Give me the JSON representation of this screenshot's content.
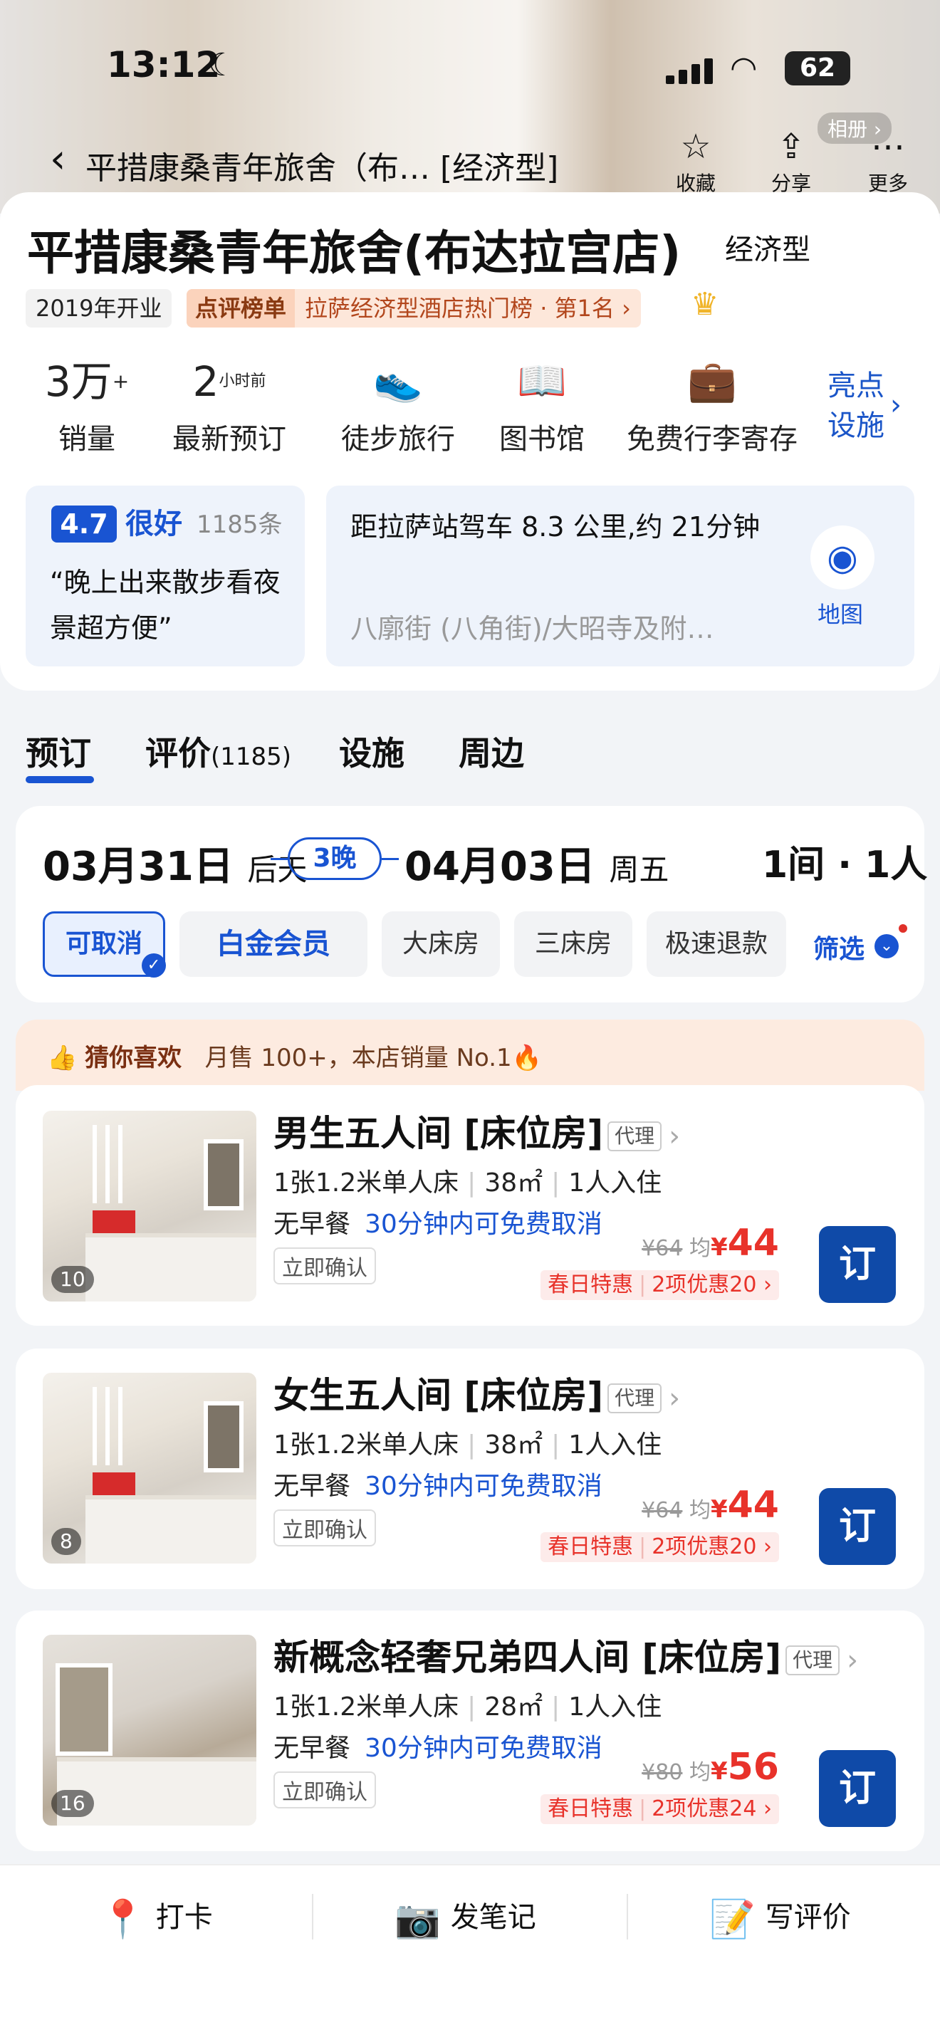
{
  "status_bar": {
    "time": "13:12",
    "moon": "☾",
    "wifi": "📶",
    "battery": "62"
  },
  "nav": {
    "back": "‹",
    "title": "平措康桑青年旅舍（布… [经济型]",
    "album": "相册 ›",
    "actions": [
      {
        "icon": "☆",
        "label": "收藏"
      },
      {
        "icon": "⇪",
        "label": "分享"
      },
      {
        "icon": "⋯",
        "label": "更多"
      }
    ]
  },
  "hotel": {
    "name": "平措康桑青年旅舍(布达拉宫店)",
    "type": "经济型",
    "opened": "2019年开业",
    "rank_badge": "点评榜单",
    "rank_text": "拉萨经济型酒店热门榜 · 第1名 ›",
    "crown": "♛"
  },
  "stats": [
    {
      "value": "3万",
      "sup": "+",
      "label": "销量"
    },
    {
      "value": "2",
      "small": "小时前",
      "label": "最新预订"
    }
  ],
  "facilities": [
    {
      "icon": "👟",
      "label": "徒步旅行"
    },
    {
      "icon": "📖",
      "label": "图书馆"
    },
    {
      "icon": "💼",
      "label": "免费行李寄存"
    }
  ],
  "highlights_link": "亮点\n设施",
  "highlights_chev": "›",
  "rating": {
    "score": "4.7",
    "word": "很好",
    "count": "1185条",
    "quote": "“晚上出来散步看夜景超方便”"
  },
  "location": {
    "text": "距拉萨站驾车 8.3 公里,约 21分钟",
    "sub": "八廓街 (八角街)/大昭寺及附…",
    "map_icon": "◉",
    "map_label": "地图"
  },
  "tabs": [
    {
      "label": "预订",
      "extra": ""
    },
    {
      "label": "评价",
      "extra": "(1185)"
    },
    {
      "label": "设施",
      "extra": ""
    },
    {
      "label": "周边",
      "extra": ""
    }
  ],
  "booking": {
    "checkin_md": "03月31日",
    "checkin_rel": "后天",
    "nights": "3晚",
    "checkout_md": "04月03日",
    "checkout_rel": "周五",
    "rooms_guests": "1间 · 1人",
    "chips": [
      "可取消",
      "白金会员",
      "大床房",
      "三床房",
      "极速退款"
    ],
    "chip_check": "✓",
    "filter_label": "筛选",
    "filter_icon": "⌄"
  },
  "guess": {
    "icon": "👍",
    "title": "猜你喜欢",
    "text": "月售 100+，本店销量 No.1",
    "fire": "🔥"
  },
  "rooms": [
    {
      "name": "男生五人间 [床位房]",
      "agent": "代理",
      "chev": "›",
      "img_count": "10",
      "bed": "1张1.2米单人床",
      "area": "38㎡",
      "occupancy": "1人入住",
      "meal": "无早餐",
      "cancel": "30分钟内可免费取消",
      "confirm": "立即确认",
      "orig_price": "¥64",
      "avg": "均",
      "yen": "¥",
      "price": "44",
      "promo1": "春日特惠",
      "promo2": "2项优惠20 ›",
      "book": "订"
    },
    {
      "name": "女生五人间 [床位房]",
      "agent": "代理",
      "chev": "›",
      "img_count": "8",
      "bed": "1张1.2米单人床",
      "area": "38㎡",
      "occupancy": "1人入住",
      "meal": "无早餐",
      "cancel": "30分钟内可免费取消",
      "confirm": "立即确认",
      "orig_price": "¥64",
      "avg": "均",
      "yen": "¥",
      "price": "44",
      "promo1": "春日特惠",
      "promo2": "2项优惠20 ›",
      "book": "订"
    },
    {
      "name": "新概念轻奢兄弟四人间 [床位房]",
      "agent": "代理",
      "chev": "›",
      "img_count": "16",
      "bed": "1张1.2米单人床",
      "area": "28㎡",
      "occupancy": "1人入住",
      "meal": "无早餐",
      "cancel": "30分钟内可免费取消",
      "confirm": "立即确认",
      "orig_price": "¥80",
      "avg": "均",
      "yen": "¥",
      "price": "56",
      "promo1": "春日特惠",
      "promo2": "2项优惠24 ›",
      "book": "订"
    }
  ],
  "bottom_bar": [
    {
      "icon": "📍",
      "label": "打卡"
    },
    {
      "icon": "📷",
      "label": "发笔记"
    },
    {
      "icon": "📝",
      "label": "写评价"
    }
  ]
}
